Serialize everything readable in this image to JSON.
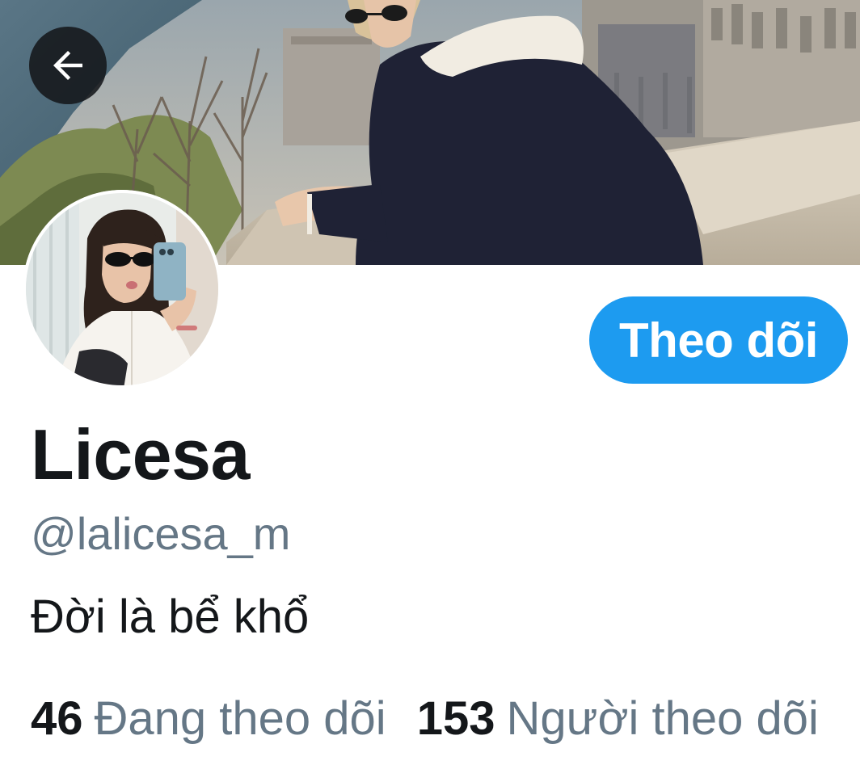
{
  "profile": {
    "display_name": "Licesa",
    "handle": "@lalicesa_m",
    "bio": "Đời là bể khổ"
  },
  "actions": {
    "follow_label": "Theo dõi"
  },
  "stats": {
    "following_count": "46",
    "following_label": "Đang theo dõi",
    "followers_count": "153",
    "followers_label": "Người theo dõi"
  },
  "icons": {
    "back": "arrow-left-icon"
  },
  "colors": {
    "accent": "#1d9bf0",
    "text_primary": "#14171a",
    "text_secondary": "#657786",
    "back_button_bg": "#14171a"
  }
}
